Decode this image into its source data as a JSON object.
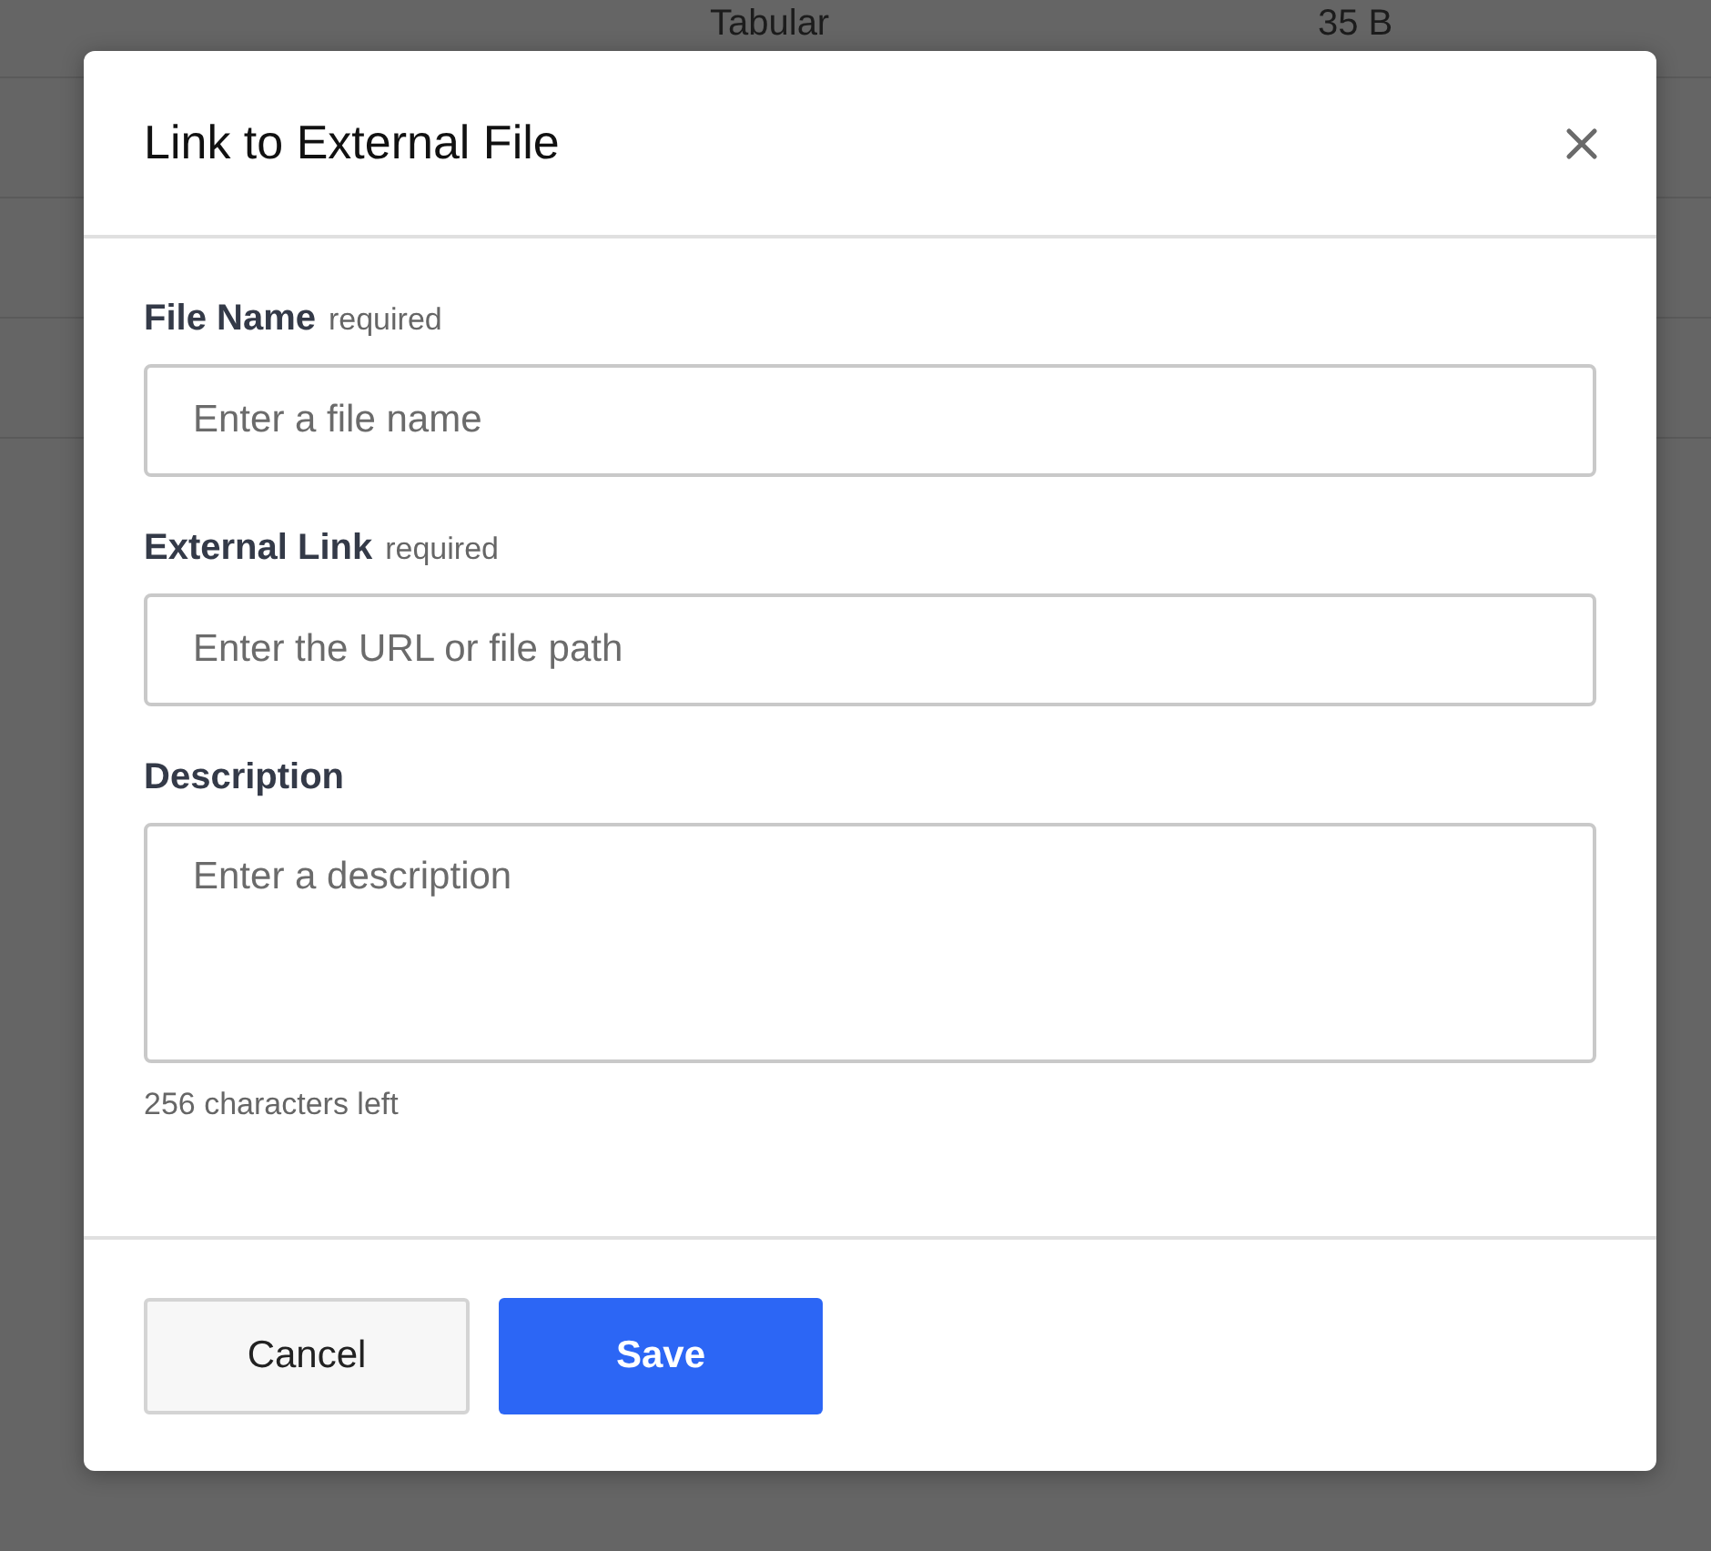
{
  "background_table": {
    "rows": [
      {
        "type": "Tabular",
        "size": "35 B"
      }
    ]
  },
  "dialog": {
    "title": "Link to External File",
    "fields": [
      {
        "kind": "input",
        "label": "File Name",
        "note": "required",
        "placeholder": "Enter a file name"
      },
      {
        "kind": "input",
        "label": "External Link",
        "note": "required",
        "placeholder": "Enter the URL or file path"
      },
      {
        "kind": "textarea",
        "label": "Description",
        "placeholder": "Enter a description",
        "helper": "256 characters left"
      }
    ],
    "buttons": [
      {
        "label": "Cancel",
        "kind": "secondary"
      },
      {
        "label": "Save",
        "kind": "primary"
      }
    ]
  }
}
